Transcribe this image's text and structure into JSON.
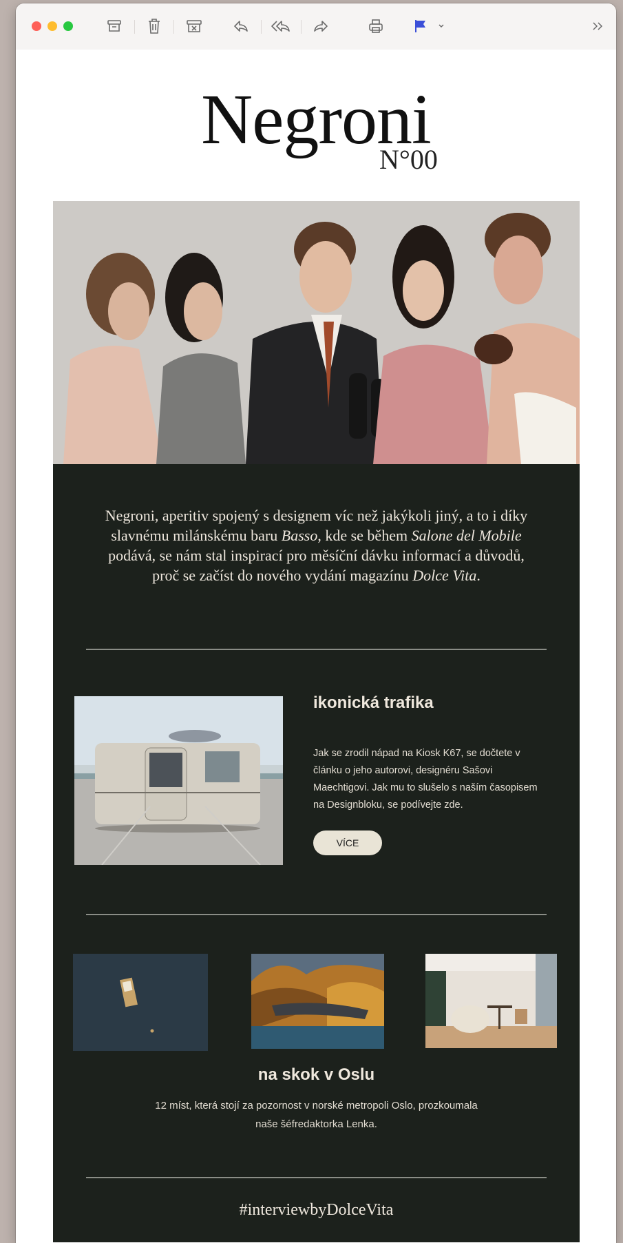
{
  "toolbar": {
    "icons": [
      "archive-icon",
      "trash-icon",
      "junk-icon",
      "reply-icon",
      "reply-all-icon",
      "forward-icon",
      "print-icon",
      "flag-icon",
      "chevron-down-icon",
      "more-icon"
    ],
    "flag_color": "#3b4fd8"
  },
  "newsletter": {
    "logo": "Negroni",
    "issue": "N°00",
    "intro": {
      "part1": "Negroni, aperitiv spojený s designem víc než jakýkoli jiný, a to i díky slavnému milánskému baru ",
      "italic1": "Basso",
      "part2": ", kde se během ",
      "italic2": "Salone del Mobile",
      "part3": " podává, se nám stal inspirací pro měsíční dávku informací a důvodů, proč se začíst do nového vydání magazínu ",
      "italic3": "Dolce Vita",
      "part4": "."
    },
    "article": {
      "title": "ikonická trafika",
      "body": "Jak se zrodil nápad na Kiosk K67, se dočtete v článku o jeho autorovi, designéru Sašovi Maechtigovi. Jak mu to slušelo s naším časopisem na Designbloku, se podívejte zde.",
      "button": "VÍCE"
    },
    "oslo": {
      "title": "na skok v Oslu",
      "body": "12 míst, která stojí za pozornost v norské metropoli Oslo, prozkoumala naše šéfredaktorka Lenka."
    },
    "hashtag": "#interviewbyDolceVita"
  },
  "colors": {
    "dark_background": "#1c211c",
    "button_background": "#e9e4d6",
    "text_light": "#ede6dc"
  }
}
